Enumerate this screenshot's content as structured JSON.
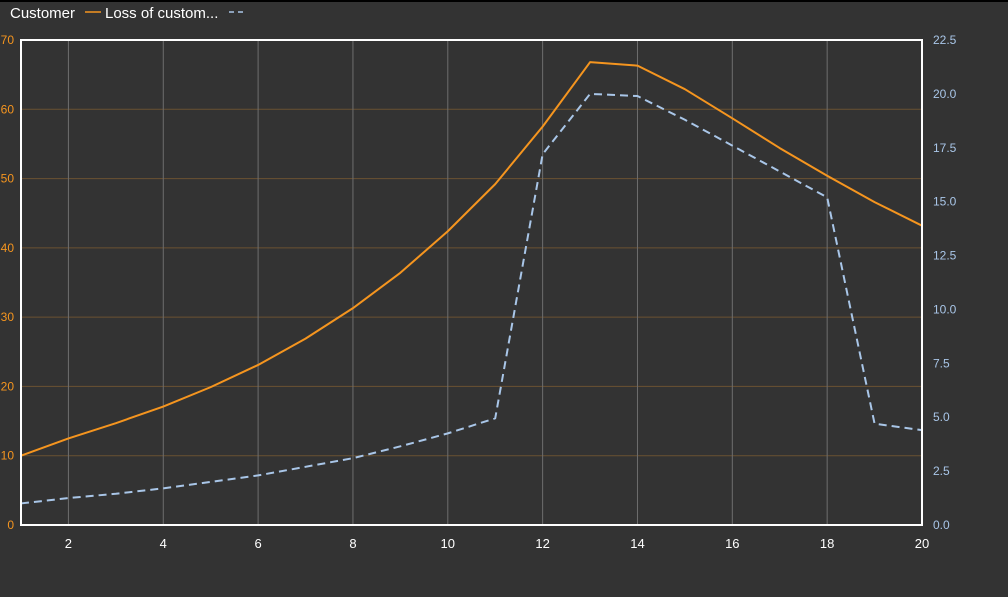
{
  "chart_data": {
    "type": "line",
    "x": [
      1,
      2,
      3,
      4,
      5,
      6,
      7,
      8,
      9,
      10,
      11,
      12,
      13,
      14,
      15,
      16,
      17,
      18,
      19,
      20
    ],
    "xlim": [
      1,
      20
    ],
    "x_ticks": [
      "2",
      "4",
      "6",
      "8",
      "10",
      "12",
      "14",
      "16",
      "18",
      "20"
    ],
    "y_left": {
      "lim": [
        0,
        70
      ],
      "ticks": [
        "0",
        "10",
        "20",
        "30",
        "40",
        "50",
        "60",
        "70"
      ]
    },
    "y_right": {
      "lim": [
        0,
        22.5
      ],
      "ticks": [
        "0.0",
        "2.5",
        "5.0",
        "7.5",
        "10.0",
        "12.5",
        "15.0",
        "17.5",
        "20.0",
        "22.5"
      ]
    },
    "grid": true,
    "legend_position": "top-left",
    "series": [
      {
        "name": "Customer",
        "axis": "left",
        "style": "solid",
        "color": "#f5951f",
        "values": [
          10,
          12.5,
          14.7,
          17.1,
          19.9,
          23.1,
          26.9,
          31.3,
          36.4,
          42.4,
          49.2,
          57.5,
          66.8,
          66.3,
          62.9,
          58.7,
          54.4,
          50.4,
          46.6,
          43.2
        ]
      },
      {
        "name": "Loss of custom...",
        "axis": "right",
        "style": "dashed",
        "color": "#a9c6e8",
        "values": [
          1.0,
          1.25,
          1.45,
          1.7,
          2.0,
          2.3,
          2.7,
          3.1,
          3.65,
          4.25,
          4.95,
          17.2,
          20.0,
          19.9,
          18.8,
          17.6,
          16.4,
          15.2,
          4.7,
          4.4
        ]
      }
    ]
  },
  "colors": {
    "background": "#333333",
    "plot_border": "#ffffff",
    "grid_horizontal": "#6b5233",
    "grid_vertical": "#6e6e6e",
    "left_axis_text": "#f5951f",
    "right_axis_text": "#a9c6e8",
    "x_axis_text": "#ffffff"
  }
}
